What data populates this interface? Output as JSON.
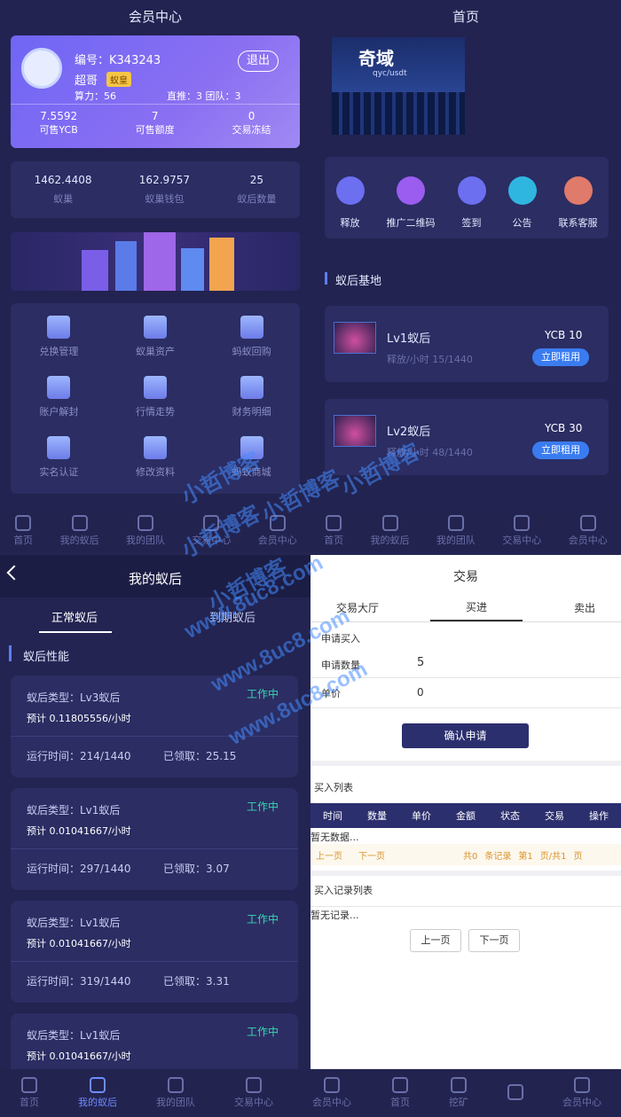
{
  "member": {
    "title": "会员中心",
    "id": "编号：K343243",
    "name": "超哥",
    "badge": "蚁皇",
    "logout": "退出",
    "power": "算力：56",
    "direct": "直推：3 团队：3",
    "stats": [
      {
        "value": "7.5592",
        "label": "可售YCB"
      },
      {
        "value": "7",
        "label": "可售额度"
      },
      {
        "value": "0",
        "label": "交易冻结"
      }
    ],
    "wallet": [
      {
        "value": "1462.4408",
        "label": "蚁巢"
      },
      {
        "value": "162.9757",
        "label": "蚁巢钱包"
      },
      {
        "value": "25",
        "label": "蚁后数量"
      }
    ],
    "grid": [
      "兑换管理",
      "蚁巢资产",
      "蚂蚁回购",
      "账户解封",
      "行情走势",
      "财务明细",
      "实名认证",
      "修改资料",
      "蚂蚁商城"
    ]
  },
  "home": {
    "title": "首页",
    "banner_logo": "奇域",
    "banner_sub": "qyc/usdt",
    "quick": [
      {
        "label": "释放",
        "color": "#6b6ff0"
      },
      {
        "label": "推广二维码",
        "color": "#9b5cf0"
      },
      {
        "label": "签到",
        "color": "#6b6ff0"
      },
      {
        "label": "公告",
        "color": "#2fb6e0"
      },
      {
        "label": "联系客服",
        "color": "#e07a6a"
      }
    ],
    "section": "蚁后基地",
    "queens": [
      {
        "name": "Lv1蚁后",
        "sub": "释放/小时 15/1440",
        "price": "YCB 10",
        "btn": "立即租用"
      },
      {
        "name": "Lv2蚁后",
        "sub": "释放/小时 48/1440",
        "price": "YCB 30",
        "btn": "立即租用"
      }
    ]
  },
  "nav_top": [
    "首页",
    "我的蚁后",
    "我的团队",
    "交易中心",
    "会员中心",
    "首页",
    "我的蚁后",
    "我的团队",
    "交易中心",
    "会员中心"
  ],
  "myqueen": {
    "title": "我的蚁后",
    "tabs": [
      "正常蚁后",
      "到期蚁后"
    ],
    "section": "蚁后性能",
    "cards": [
      {
        "type": "蚁后类型：Lv3蚁后",
        "status": "工作中",
        "rate": "预计 0.11805556/小时",
        "run": "运行时间：214/1440",
        "got": "已领取：25.15"
      },
      {
        "type": "蚁后类型：Lv1蚁后",
        "status": "工作中",
        "rate": "预计 0.01041667/小时",
        "run": "运行时间：297/1440",
        "got": "已领取：3.07"
      },
      {
        "type": "蚁后类型：Lv1蚁后",
        "status": "工作中",
        "rate": "预计 0.01041667/小时",
        "run": "运行时间：319/1440",
        "got": "已领取：3.31"
      },
      {
        "type": "蚁后类型：Lv1蚁后",
        "status": "工作中",
        "rate": "预计 0.01041667/小时",
        "run": "",
        "got": ""
      }
    ]
  },
  "trade": {
    "title": "交易",
    "tabs": [
      "交易大厅",
      "买进",
      "卖出"
    ],
    "apply": "申请买入",
    "qty_label": "申请数量",
    "qty": "5",
    "price_label": "单价",
    "price": "0",
    "confirm": "确认申请",
    "buy_list": "买入列表",
    "cols": [
      "时间",
      "数量",
      "单价",
      "金额",
      "状态",
      "交易",
      "操作"
    ],
    "empty": "暂无数据...",
    "prev": "上一页",
    "next": "下一页",
    "total": "共0",
    "records": "条记录",
    "page": "第1",
    "pages": "页/共1",
    "pg": "页",
    "rec_list": "买入记录列表",
    "rec_empty": "暂无记录...",
    "btn_prev": "上一页",
    "btn_next": "下一页"
  },
  "nav_bottom": [
    "首页",
    "我的蚁后",
    "我的团队",
    "交易中心",
    "会员中心",
    "首页",
    "挖矿",
    "",
    "会员中心"
  ],
  "watermark": [
    "小哲博客",
    "小哲博客",
    "小哲博客",
    "小哲博客",
    "小哲博客",
    "www.8uc8.com",
    "www.8uc8.com",
    "www.8uc8.com"
  ]
}
